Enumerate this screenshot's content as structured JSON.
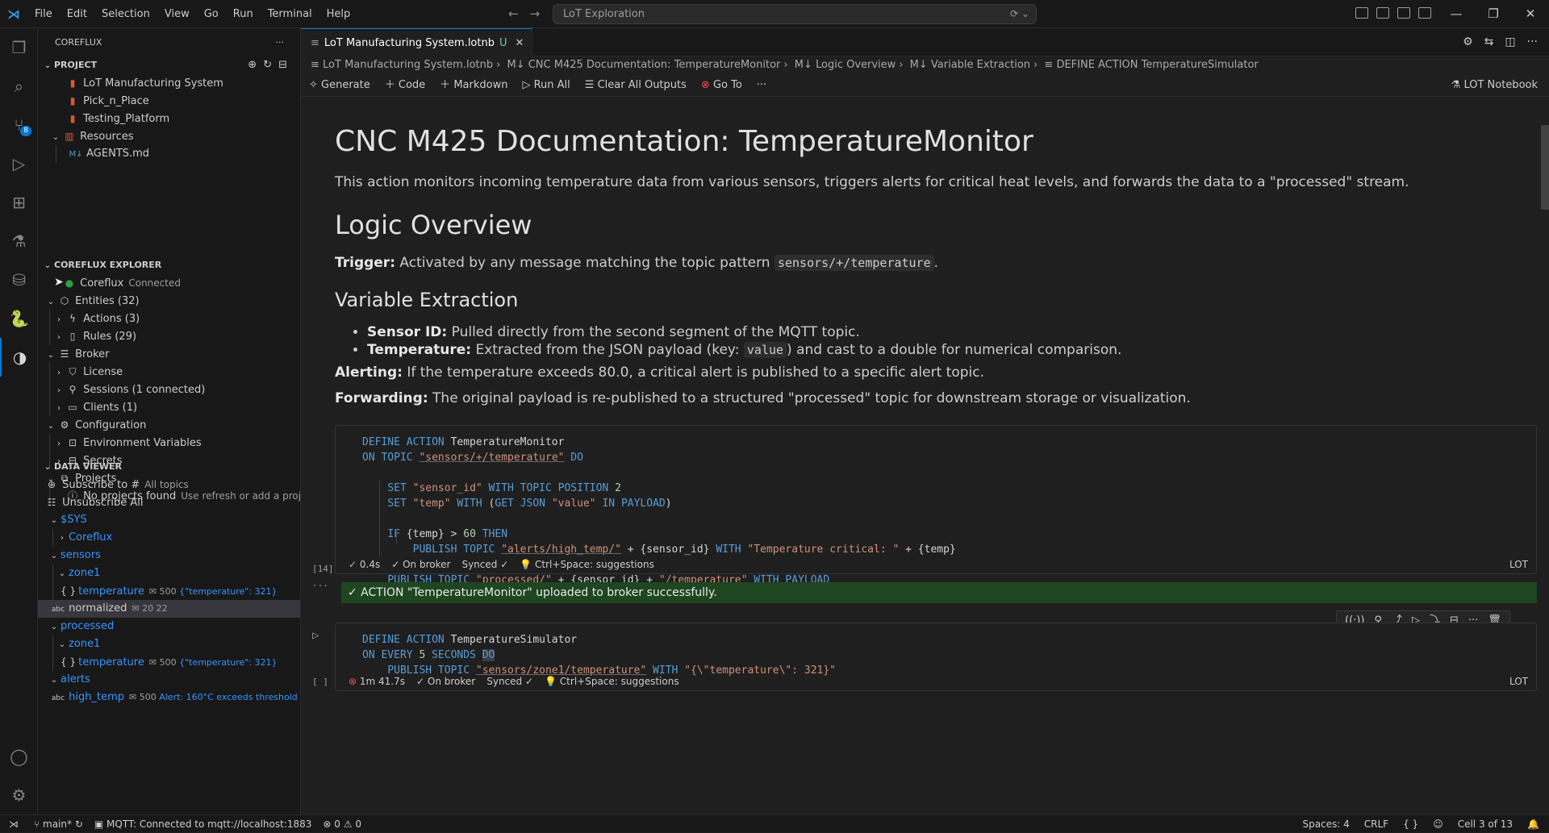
{
  "titlebar": {
    "menu": [
      "File",
      "Edit",
      "Selection",
      "View",
      "Go",
      "Run",
      "Terminal",
      "Help"
    ],
    "search": "LoT Exploration"
  },
  "activitybar": {
    "items": [
      "explorer-icon",
      "search-icon",
      "source-control-icon",
      "run-debug-icon",
      "extensions-icon",
      "testing-icon",
      "database-icon",
      "python-icon",
      "coreflux-icon"
    ],
    "scm_badge": "8"
  },
  "sidebar": {
    "title": "COREFLUX",
    "project": {
      "header": "PROJECT",
      "items": [
        "LoT Manufacturing System",
        "Pick_n_Place",
        "Testing_Platform",
        "Resources",
        "AGENTS.md"
      ]
    },
    "explorer": {
      "header": "COREFLUX EXPLORER",
      "connection_name": "Coreflux",
      "connection_status": "Connected",
      "entities": "Entities (32)",
      "actions": "Actions (3)",
      "rules": "Rules (29)",
      "broker": "Broker",
      "license": "License",
      "sessions": "Sessions (1 connected)",
      "clients": "Clients (1)",
      "configuration": "Configuration",
      "env": "Environment Variables",
      "secrets": "Secrets",
      "projects": "Projects",
      "no_projects": "No projects found",
      "no_projects_hint": "Use refresh or add a proj..."
    },
    "dataviewer": {
      "header": "DATA VIEWER",
      "subscribe": "Subscribe to #",
      "subscribe_hint": "All topics",
      "unsubscribe": "Unsubscribe All",
      "sys": "$SYS",
      "coreflux": "Coreflux",
      "sensors": "sensors",
      "zone1": "zone1",
      "temperature": "temperature",
      "temperature_meta_count": "500",
      "temperature_meta_value": "{\"temperature\": 321}",
      "normalized": "normalized",
      "normalized_meta": "20 22",
      "processed": "processed",
      "zone1b": "zone1",
      "temperature2": "temperature",
      "temperature2_meta_count": "500",
      "temperature2_meta_value": "{\"temperature\": 321}",
      "alerts": "alerts",
      "high_temp": "high_temp",
      "high_temp_meta_count": "500",
      "high_temp_meta_value": "Alert: 160°C exceeds threshold"
    }
  },
  "editor": {
    "tab": {
      "label": "LoT Manufacturing System.lotnb",
      "modified": "U"
    },
    "breadcrumb": [
      "LoT Manufacturing System.lotnb",
      "CNC M425 Documentation: TemperatureMonitor",
      "Logic Overview",
      "Variable Extraction",
      "DEFINE ACTION TemperatureSimulator"
    ],
    "toolbar": {
      "generate": "Generate",
      "code": "Code",
      "markdown": "Markdown",
      "run_all": "Run All",
      "clear": "Clear All Outputs",
      "goto": "Go To",
      "kernel": "LOT Notebook"
    },
    "md": {
      "h1": "CNC M425 Documentation: TemperatureMonitor",
      "intro": "This action monitors incoming temperature data from various sensors, triggers alerts for critical heat levels, and forwards the data to a \"processed\" stream.",
      "h2": "Logic Overview",
      "trigger_label": "Trigger:",
      "trigger_text": " Activated by any message matching the topic pattern ",
      "trigger_code": "sensors/+/temperature",
      "h3": "Variable Extraction",
      "b1_label": "Sensor ID:",
      "b1_text": " Pulled directly from the second segment of the MQTT topic.",
      "b2_label": "Temperature:",
      "b2_text_a": " Extracted from the JSON payload (key: ",
      "b2_code": "value",
      "b2_text_b": ") and cast to a double for numerical comparison.",
      "alert_label": "Alerting:",
      "alert_text": " If the temperature exceeds 80.0, a critical alert is published to a specific alert topic.",
      "fwd_label": "Forwarding:",
      "fwd_text": " The original payload is re-published to a structured \"processed\" topic for downstream storage or visualization."
    },
    "cell1": {
      "exec": "[14]",
      "time": "0.4s",
      "broker": "On broker",
      "synced": "Synced",
      "hint": "Ctrl+Space: suggestions",
      "lang": "LOT",
      "output": "✓ ACTION \"TemperatureMonitor\" uploaded to broker successfully."
    },
    "cell2": {
      "exec": "[ ]",
      "time": "1m 41.7s",
      "broker": "On broker",
      "synced": "Synced",
      "hint": "Ctrl+Space: suggestions",
      "lang": "LOT"
    }
  },
  "statusbar": {
    "branch": "main*",
    "mqtt": "MQTT: Connected to mqtt://localhost:1883",
    "errors": "0",
    "warnings": "0",
    "spaces": "Spaces: 4",
    "eol": "CRLF",
    "braces": "{ }",
    "cell": "Cell 3 of 13"
  }
}
